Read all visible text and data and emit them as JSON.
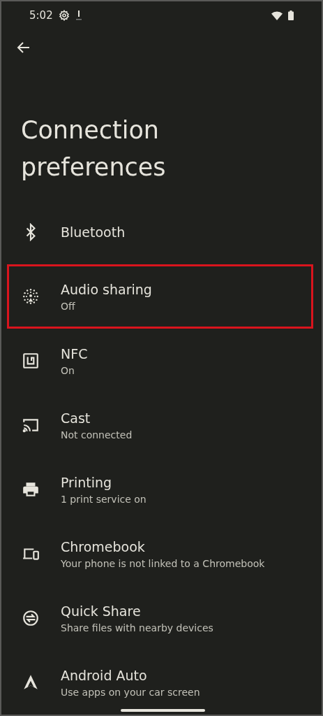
{
  "status_bar": {
    "time": "5:02"
  },
  "title": "Connection preferences",
  "items": [
    {
      "kind": "bluetooth",
      "title": "Bluetooth",
      "highlighted": false
    },
    {
      "kind": "audio",
      "title": "Audio sharing",
      "summary": "Off",
      "highlighted": true
    },
    {
      "kind": "nfc",
      "title": "NFC",
      "summary": "On",
      "highlighted": false
    },
    {
      "kind": "cast",
      "title": "Cast",
      "summary": "Not connected",
      "highlighted": false
    },
    {
      "kind": "printer",
      "title": "Printing",
      "summary": "1 print service on",
      "highlighted": false
    },
    {
      "kind": "devices",
      "title": "Chromebook",
      "summary": "Your phone is not linked to a Chromebook",
      "highlighted": false
    },
    {
      "kind": "share",
      "title": "Quick Share",
      "summary": "Share files with nearby devices",
      "highlighted": false
    },
    {
      "kind": "auto",
      "title": "Android Auto",
      "summary": "Use apps on your car screen",
      "highlighted": false
    }
  ]
}
